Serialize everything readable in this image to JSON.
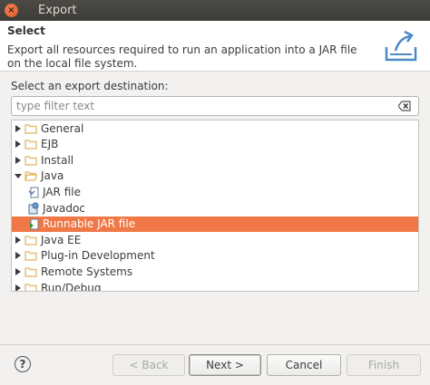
{
  "window": {
    "title": "Export",
    "close_glyph": "×"
  },
  "header": {
    "title": "Select",
    "description": "Export all resources required to run an application into a JAR file on the local file system.",
    "icon": "export-icon"
  },
  "destination_label": "Select an export destination:",
  "filter": {
    "placeholder": "type filter text",
    "value": ""
  },
  "tree": {
    "items": [
      {
        "label": "General",
        "kind": "folder",
        "expanded": false,
        "depth": 0,
        "selected": false
      },
      {
        "label": "EJB",
        "kind": "folder",
        "expanded": false,
        "depth": 0,
        "selected": false
      },
      {
        "label": "Install",
        "kind": "folder",
        "expanded": false,
        "depth": 0,
        "selected": false
      },
      {
        "label": "Java",
        "kind": "folder",
        "expanded": true,
        "depth": 0,
        "selected": false
      },
      {
        "label": "JAR file",
        "kind": "jar",
        "depth": 1,
        "selected": false
      },
      {
        "label": "Javadoc",
        "kind": "javadoc",
        "depth": 1,
        "selected": false
      },
      {
        "label": "Runnable JAR file",
        "kind": "runnable-jar",
        "depth": 1,
        "selected": true
      },
      {
        "label": "Java EE",
        "kind": "folder",
        "expanded": false,
        "depth": 0,
        "selected": false
      },
      {
        "label": "Plug-in Development",
        "kind": "folder",
        "expanded": false,
        "depth": 0,
        "selected": false
      },
      {
        "label": "Remote Systems",
        "kind": "folder",
        "expanded": false,
        "depth": 0,
        "selected": false
      },
      {
        "label": "Run/Debug",
        "kind": "folder",
        "expanded": false,
        "depth": 0,
        "selected": false
      }
    ]
  },
  "buttons": {
    "help": "?",
    "back": "< Back",
    "next": "Next >",
    "cancel": "Cancel",
    "finish": "Finish"
  },
  "colors": {
    "selection": "#f07746",
    "titlebar": "#3d3c38",
    "folder": "#e2b55b"
  }
}
